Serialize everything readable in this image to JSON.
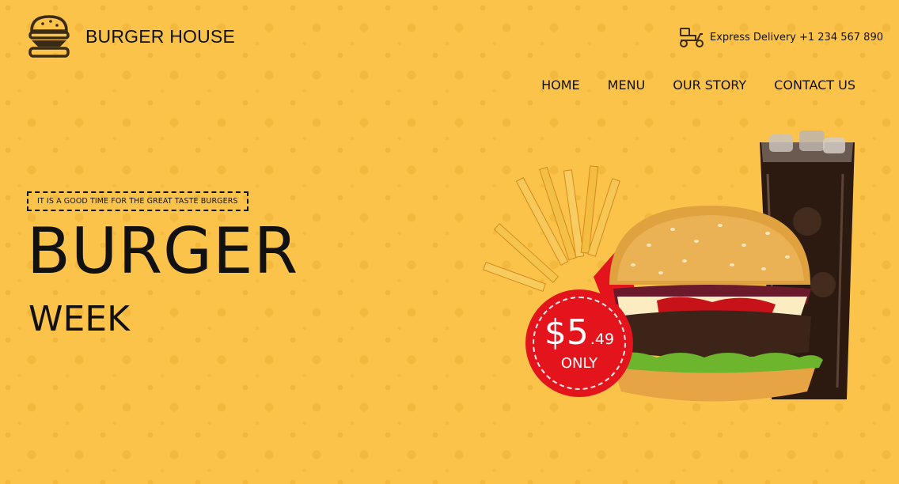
{
  "brand": {
    "name": "BURGER HOUSE",
    "logo_icon": "burger-icon"
  },
  "delivery": {
    "icon": "scooter-icon",
    "text": "Express Delivery +1 234 567 890"
  },
  "nav": {
    "items": [
      {
        "label": "HOME"
      },
      {
        "label": "MENU"
      },
      {
        "label": "OUR STORY"
      },
      {
        "label": "CONTACT US"
      }
    ]
  },
  "hero": {
    "tagline": "IT IS A GOOD TIME FOR THE GREAT TASTE BURGERS",
    "title": "BURGER",
    "subtitle": "WEEK"
  },
  "offer": {
    "price_main": "$5",
    "price_cents": ".49",
    "label": "ONLY"
  },
  "colors": {
    "background": "#fcc34a",
    "badge": "#e3141b",
    "text": "#111111"
  }
}
